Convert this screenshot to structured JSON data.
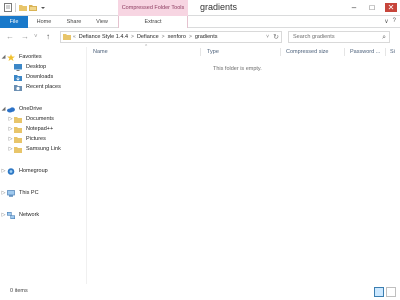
{
  "window": {
    "title": "gradients",
    "contextual_group": "Compressed Folder Tools",
    "minimize": "–",
    "maximize": "□",
    "close": "✕"
  },
  "ribbon": {
    "tabs": [
      "File",
      "Home",
      "Share",
      "View",
      "Extract"
    ],
    "collapse_icon": "∨",
    "help_icon": "?"
  },
  "navigation": {
    "back": "←",
    "forward": "→",
    "recent": "˅",
    "up": "↑",
    "address_prefix": "«",
    "breadcrumbs": [
      "Defiance Style 1.4.4",
      "Defiance",
      "xenforo",
      "gradients"
    ],
    "address_dropdown": "˅",
    "refresh": "↻",
    "search_placeholder": "Search gradients",
    "search_icon": "⌕"
  },
  "sidebar": {
    "items": [
      {
        "label": "Favorites",
        "icon": "star-icon",
        "color": "#f2c12e",
        "level": 0,
        "expanded": true
      },
      {
        "label": "Desktop",
        "icon": "desktop-icon",
        "color": "#3c87c7",
        "level": 1
      },
      {
        "label": "Downloads",
        "icon": "downloads-icon",
        "color": "#3c87c7",
        "level": 1
      },
      {
        "label": "Recent places",
        "icon": "recent-places-icon",
        "color": "#6b8fb3",
        "level": 1
      },
      {
        "label": "OneDrive",
        "icon": "onedrive-icon",
        "color": "#2c72c7",
        "level": 0,
        "expanded": true
      },
      {
        "label": "Documents",
        "icon": "folder-icon",
        "color": "#e8c56a",
        "level": 1
      },
      {
        "label": "Notepad++",
        "icon": "folder-icon",
        "color": "#e8c56a",
        "level": 1
      },
      {
        "label": "Pictures",
        "icon": "folder-icon",
        "color": "#e8c56a",
        "level": 1
      },
      {
        "label": "Samsung Link",
        "icon": "folder-icon",
        "color": "#e8c56a",
        "level": 1
      },
      {
        "label": "Homegroup",
        "icon": "homegroup-icon",
        "color": "#2f78c4",
        "level": 0
      },
      {
        "label": "This PC",
        "icon": "this-pc-icon",
        "color": "#4a7fb5",
        "level": 0
      },
      {
        "label": "Network",
        "icon": "network-icon",
        "color": "#4a7fb5",
        "level": 0
      }
    ]
  },
  "content": {
    "columns": [
      "Name",
      "Type",
      "Compressed size",
      "Password ...",
      "Si"
    ],
    "empty_message": "This folder is empty."
  },
  "status": {
    "item_count": "0 items"
  },
  "colors": {
    "file_tab": "#1979ca",
    "contextual_tab": "#f7d5e2",
    "header_text": "#4c607a"
  }
}
